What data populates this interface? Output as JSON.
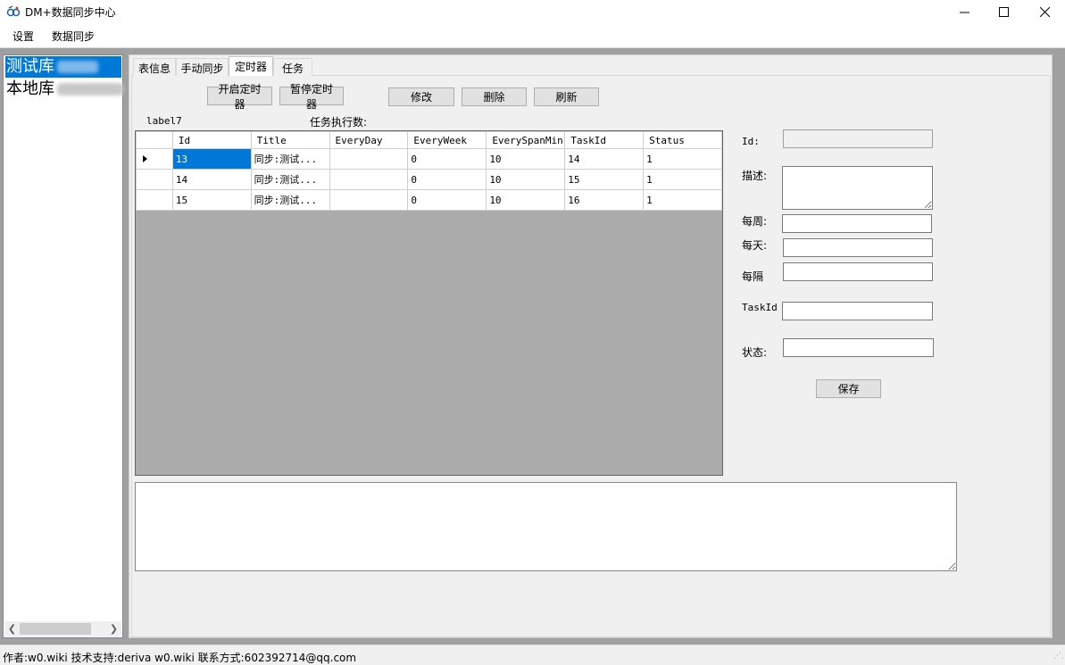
{
  "window": {
    "title": "DM+数据同步中心",
    "controls": {
      "minimize": "—",
      "maximize": "☐",
      "close": "✕"
    }
  },
  "menu": {
    "items": [
      "设置",
      "数据同步"
    ]
  },
  "tree": {
    "items": [
      {
        "label": "测试库",
        "selected": true
      },
      {
        "label": "本地库",
        "selected": false
      }
    ]
  },
  "tabs": [
    {
      "label": "表信息",
      "active": false
    },
    {
      "label": "手动同步",
      "active": false
    },
    {
      "label": "定时器",
      "active": true
    },
    {
      "label": "任务",
      "active": false
    }
  ],
  "toolbar": {
    "start_label": "开启定时器",
    "pause_label": "暂停定时器",
    "edit_label": "修改",
    "delete_label": "删除",
    "refresh_label": "刷新"
  },
  "info": {
    "label7": "label7",
    "task_count_label": "任务执行数:"
  },
  "grid": {
    "columns": [
      "Id",
      "Title",
      "EveryDay",
      "EveryWeek",
      "EverySpanMin",
      "TaskId",
      "Status"
    ],
    "rows": [
      {
        "Id": "13",
        "Title": "同步:测试...",
        "EveryDay": "",
        "EveryWeek": "0",
        "EverySpanMin": "10",
        "TaskId": "14",
        "Status": "1",
        "current": true
      },
      {
        "Id": "14",
        "Title": "同步:测试...",
        "EveryDay": "",
        "EveryWeek": "0",
        "EverySpanMin": "10",
        "TaskId": "15",
        "Status": "1",
        "current": false
      },
      {
        "Id": "15",
        "Title": "同步:测试...",
        "EveryDay": "",
        "EveryWeek": "0",
        "EverySpanMin": "10",
        "TaskId": "16",
        "Status": "1",
        "current": false
      }
    ]
  },
  "form": {
    "id_label": "Id:",
    "id_value": "",
    "desc_label": "描述:",
    "desc_value": "",
    "week_label": "每周:",
    "week_value": "",
    "day_label": "每天:",
    "day_value": "",
    "span_label": "每隔",
    "span_value": "",
    "taskid_label": "TaskId",
    "taskid_value": "",
    "status_label": "状态:",
    "status_value": "",
    "save_label": "保存"
  },
  "statusbar": {
    "text": "作者:w0.wiki  技术支持:deriva  w0.wiki  联系方式:602392714@qq.com"
  },
  "colors": {
    "selection": "#0078d7",
    "grid_background": "#ababab",
    "window_background": "#f0f0f0"
  }
}
